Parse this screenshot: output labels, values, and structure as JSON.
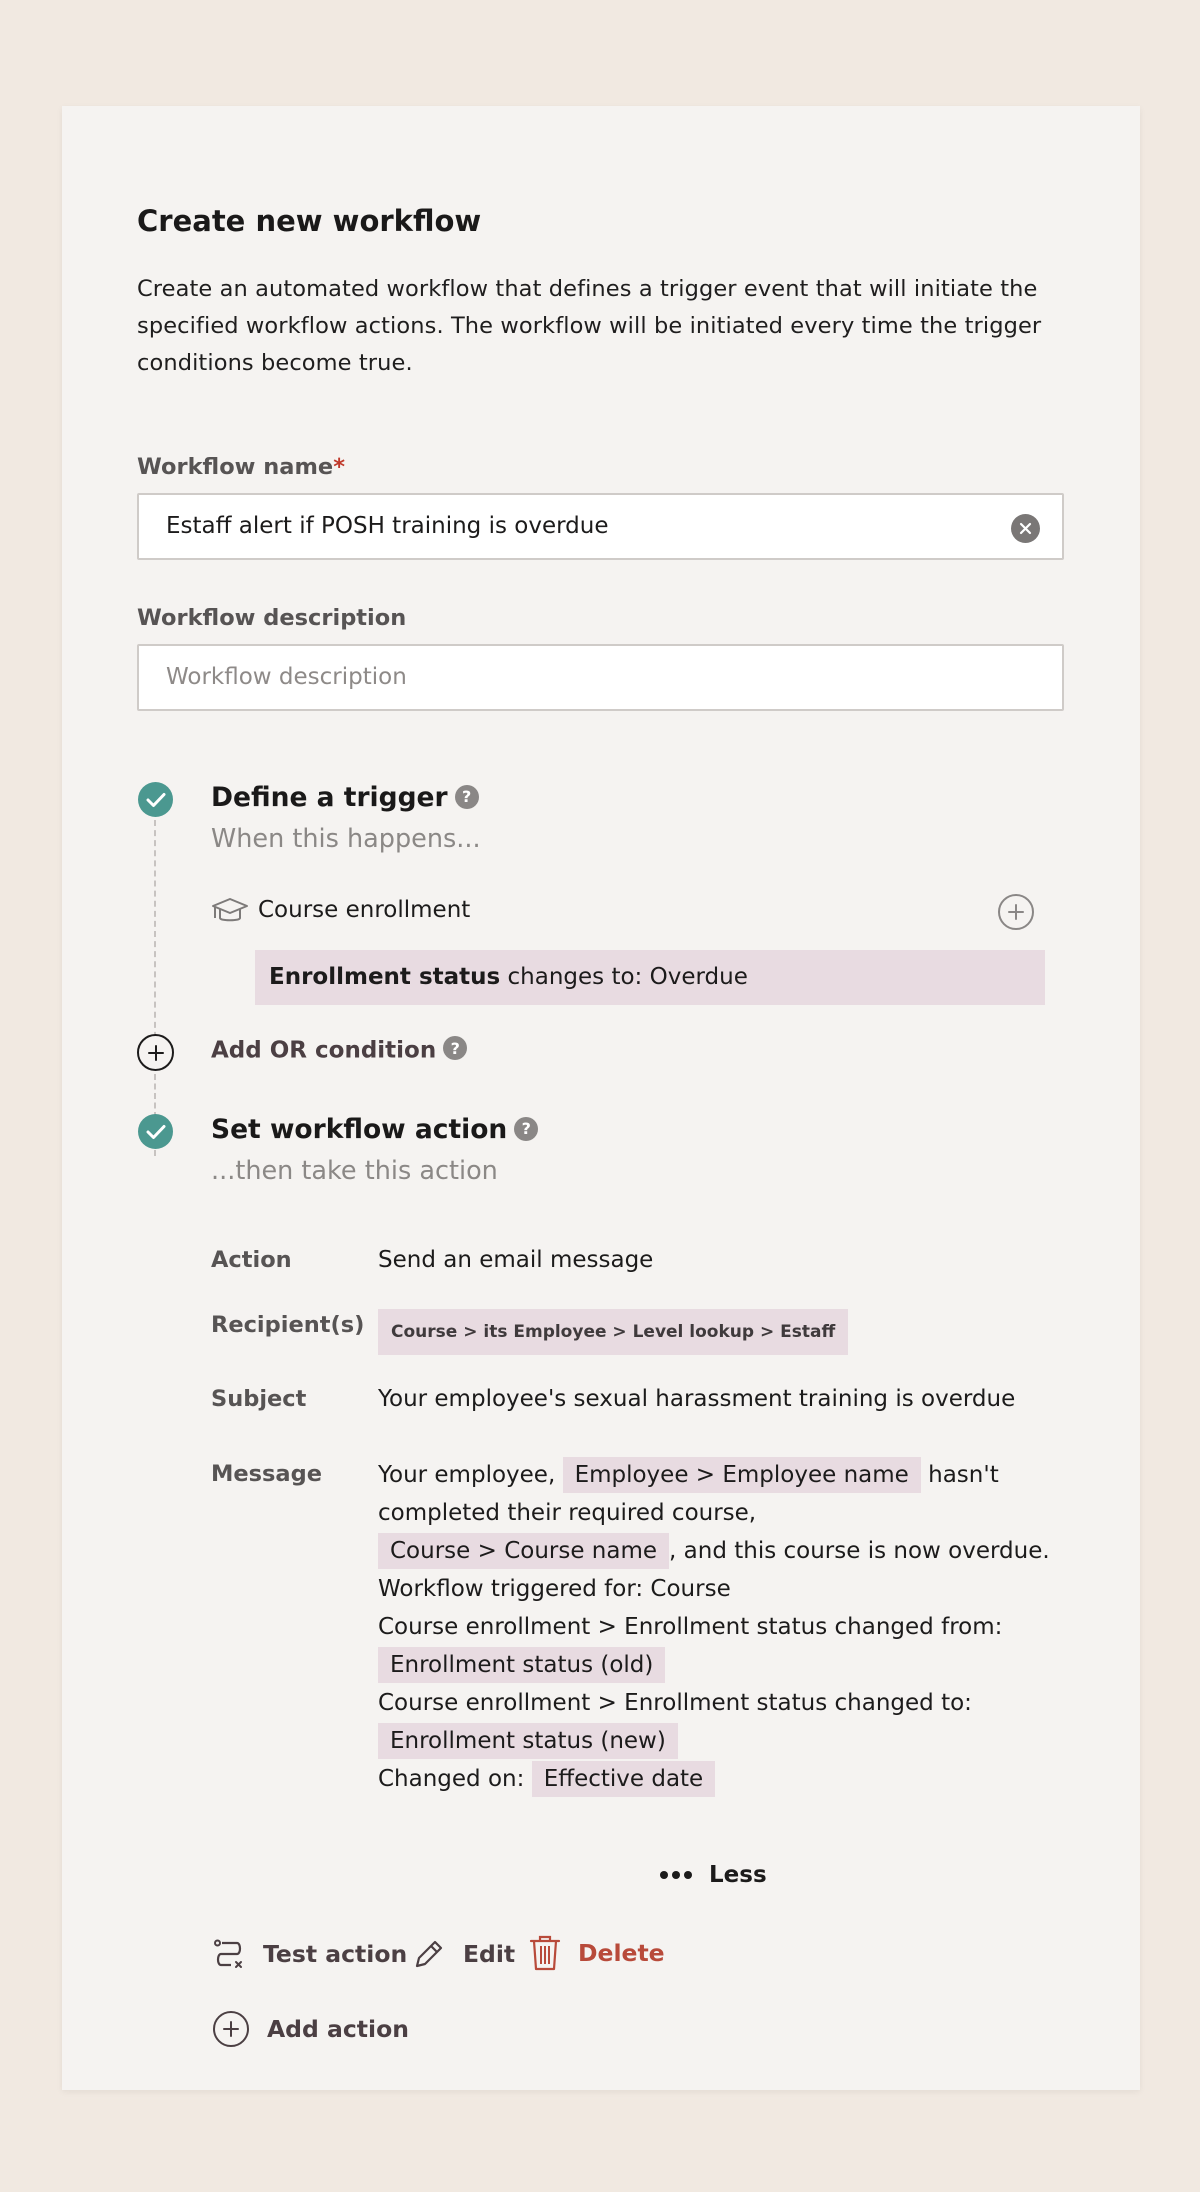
{
  "form": {
    "title": "Create new workflow",
    "description": "Create an automated workflow that defines a trigger event that will initiate the specified workflow actions. The workflow will be initiated every time the trigger conditions become true.",
    "name_label": "Workflow name",
    "required_mark": "*",
    "name_value": "Estaff alert if POSH training is overdue",
    "description_label": "Workflow description",
    "description_placeholder": "Workflow description"
  },
  "trigger": {
    "title": "Define a trigger",
    "subtitle": "When this happens...",
    "object_label": "Course enrollment",
    "condition_field": "Enrollment status",
    "condition_text": " changes to: Overdue",
    "add_or_label": "Add OR condition"
  },
  "action": {
    "title": "Set workflow action",
    "subtitle": "...then take this action",
    "action_label": "Action",
    "action_value": "Send an email message",
    "recipients_label": "Recipient(s)",
    "recipient_chip": "Course > its Employee > Level lookup > Estaff",
    "subject_label": "Subject",
    "subject_value": "Your employee's sexual harassment training is overdue",
    "message_label": "Message",
    "message": {
      "t1": "Your employee, ",
      "chip_employee": "Employee > Employee name",
      "t2": "hasn't completed their required course,",
      "chip_course": "Course > Course name",
      "t3": ", and this course is now overdue.",
      "t4": "Workflow triggered for: Course",
      "t5": "Course enrollment > Enrollment status changed from:",
      "chip_old": "Enrollment status (old)",
      "t6": "Course enrollment > Enrollment status changed to:",
      "chip_new": "Enrollment status (new)",
      "t7": "Changed on: ",
      "chip_date": "Effective date"
    },
    "less_label": "Less",
    "test_label": "Test action",
    "edit_label": "Edit",
    "delete_label": "Delete",
    "add_action_label": "Add action"
  },
  "colors": {
    "accent_teal": "#4b9890",
    "chip_bg": "#e8dbe1",
    "delete_red": "#b84a3a",
    "page_bg": "#f1e9e1",
    "card_bg": "#f5f3f1"
  }
}
